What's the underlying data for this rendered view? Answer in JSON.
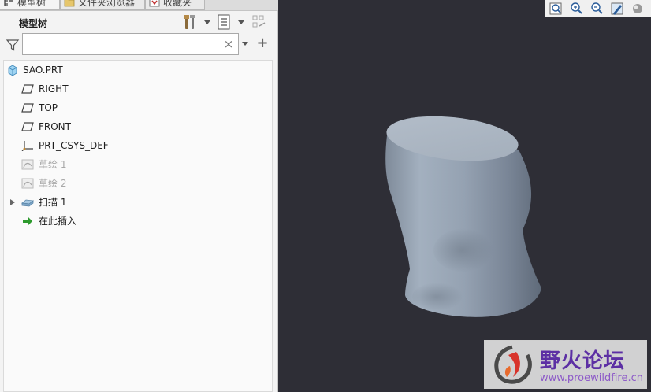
{
  "tabs": [
    {
      "label": "模型树",
      "icon": "model-tree-icon",
      "active": true
    },
    {
      "label": "文件夹浏览器",
      "icon": "folder-icon",
      "active": false
    },
    {
      "label": "收藏夹",
      "icon": "favorites-icon",
      "active": false
    }
  ],
  "panel": {
    "title": "模型树",
    "tools_icon": "settings-tools-icon",
    "display_icon": "tree-display-icon",
    "tree_filter_icon": "tree-filter-icon"
  },
  "search": {
    "value": "",
    "placeholder": "",
    "filter_icon": "filter-icon",
    "clear_icon": "close-icon",
    "clear_glyph": "×",
    "add_glyph": "+"
  },
  "tree": {
    "items": [
      {
        "label": "SAO.PRT",
        "icon": "part-icon",
        "disabled": false,
        "expandable": false
      },
      {
        "label": "RIGHT",
        "icon": "datum-plane-icon",
        "disabled": false,
        "expandable": false
      },
      {
        "label": "TOP",
        "icon": "datum-plane-icon",
        "disabled": false,
        "expandable": false
      },
      {
        "label": "FRONT",
        "icon": "datum-plane-icon",
        "disabled": false,
        "expandable": false
      },
      {
        "label": "PRT_CSYS_DEF",
        "icon": "coordinate-system-icon",
        "disabled": false,
        "expandable": false
      },
      {
        "label": "草绘 1",
        "icon": "sketch-icon",
        "disabled": true,
        "expandable": false
      },
      {
        "label": "草绘 2",
        "icon": "sketch-icon",
        "disabled": true,
        "expandable": false
      },
      {
        "label": "扫描 1",
        "icon": "sweep-icon",
        "disabled": false,
        "expandable": true
      },
      {
        "label": "在此插入",
        "icon": "insert-here-arrow-icon",
        "disabled": false,
        "expandable": false
      }
    ]
  },
  "view_toolbar": {
    "buttons": [
      "refit-icon",
      "zoom-in-icon",
      "zoom-out-icon",
      "repaint-icon",
      "display-style-icon"
    ]
  },
  "colors": {
    "graphics_bg": "#2e2e36",
    "model": "#8e9aa8",
    "panel_bg": "#f3f3f3",
    "accent": "#5c2fa4"
  },
  "watermark": {
    "title": "野火论坛",
    "url": "www.proewildfire.cn"
  }
}
